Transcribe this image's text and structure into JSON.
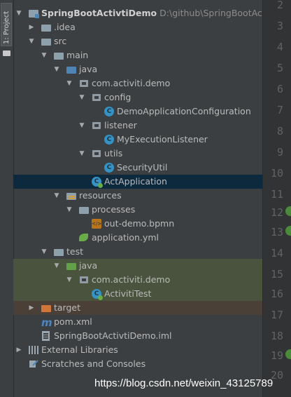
{
  "sidebar_tab": {
    "label": "1: Project"
  },
  "tree": {
    "top_partial": {
      "label": "..."
    },
    "root": {
      "name": "SpringBootActivtiDemo",
      "path": "D:\\github\\SpringBootActiviti"
    },
    "items": [
      {
        "label": ".idea"
      },
      {
        "label": "src"
      },
      {
        "label": "main"
      },
      {
        "label": "java"
      },
      {
        "label": "com.activiti.demo"
      },
      {
        "label": "config"
      },
      {
        "label": "DemoApplicationConfiguration"
      },
      {
        "label": "listener"
      },
      {
        "label": "MyExecutionListener"
      },
      {
        "label": "utils"
      },
      {
        "label": "SecurityUtil"
      },
      {
        "label": "ActApplication"
      },
      {
        "label": "resources"
      },
      {
        "label": "processes"
      },
      {
        "label": "out-demo.bpmn"
      },
      {
        "label": "application.yml"
      },
      {
        "label": "test"
      },
      {
        "label": "java"
      },
      {
        "label": "com.activiti.demo"
      },
      {
        "label": "ActivitiTest"
      },
      {
        "label": "target"
      },
      {
        "label": "pom.xml"
      },
      {
        "label": "SpringBootActivtiDemo.iml"
      },
      {
        "label": "External Libraries"
      },
      {
        "label": "Scratches and Consoles"
      }
    ]
  },
  "gutter": {
    "line_numbers": [
      "2",
      "3",
      "4",
      "5",
      "6",
      "7",
      "8",
      "9",
      "10",
      "11",
      "12",
      "13",
      "14",
      "15",
      "16",
      "17",
      "18",
      "19",
      "20"
    ]
  },
  "watermark": {
    "text": "https://blog.csdn.net/weixin_43125789"
  },
  "colors": {
    "background": "#3c3f41",
    "selection": "#0d293e",
    "test_source_bg": "#49533d",
    "excluded_bg": "#4a4038",
    "source_folder": "#4f85b5",
    "test_folder": "#62a049",
    "excluded_folder": "#d0763a"
  },
  "icons": {
    "root": "project-module-icon",
    "folder": "folder-icon",
    "package": "package-icon",
    "class": "java-class-icon",
    "spring_boot": "spring-boot-icon",
    "resources": "resources-folder-icon",
    "bpmn": "bpmn-file-icon",
    "yml": "spring-yml-icon",
    "maven": "maven-icon",
    "iml": "iml-file-icon",
    "libraries": "external-libraries-icon",
    "scratches": "scratches-icon"
  }
}
